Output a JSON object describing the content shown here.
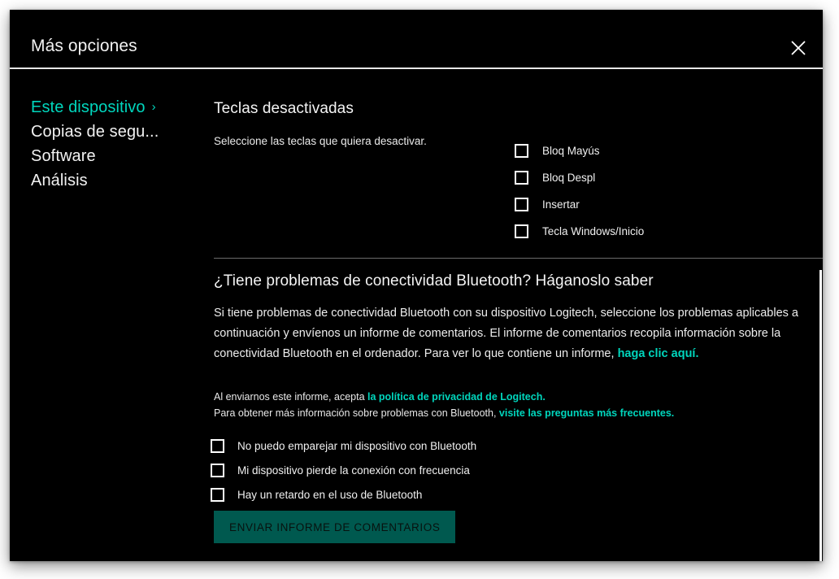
{
  "window": {
    "title": "Más opciones",
    "close_icon": "close-icon"
  },
  "colors": {
    "background": "#000000",
    "accent_teal": "#00d6bd",
    "button_bg": "#00594f",
    "text": "#f2f2f2",
    "divider": "#6b6b6b"
  },
  "sidebar": {
    "items": [
      {
        "label": "Este dispositivo",
        "active": true,
        "chevron": "›"
      },
      {
        "label": "Copias de segu...",
        "active": false
      },
      {
        "label": "Software",
        "active": false
      },
      {
        "label": "Análisis",
        "active": false
      }
    ]
  },
  "disabled_keys_section": {
    "title": "Teclas desactivadas",
    "subtitle": "Seleccione las teclas que quiera desactivar.",
    "checkboxes": [
      {
        "label": "Bloq Mayús",
        "checked": false
      },
      {
        "label": "Bloq Despl",
        "checked": false
      },
      {
        "label": "Insertar",
        "checked": false
      },
      {
        "label": "Tecla Windows/Inicio",
        "checked": false
      }
    ]
  },
  "bluetooth_section": {
    "title": "¿Tiene problemas de conectividad Bluetooth? Háganoslo saber",
    "paragraph_part1": "Si tiene problemas de conectividad Bluetooth con su dispositivo Logitech, seleccione los problemas aplicables a continuación y envíenos un informe de comentarios. El informe de comentarios recopila información sobre la conectividad Bluetooth en el ordenador. Para ver lo que contiene un informe, ",
    "paragraph_link": "haga clic aquí.",
    "fine_line1_text": "Al enviarnos este informe, acepta ",
    "fine_line1_link": "la política de privacidad de Logitech.",
    "fine_line2_text": "Para obtener más información sobre problemas con Bluetooth, ",
    "fine_line2_link": "visite las preguntas más frecuentes.",
    "issue_checkboxes": [
      {
        "label": "No puedo emparejar mi dispositivo con Bluetooth",
        "checked": false
      },
      {
        "label": "Mi dispositivo pierde la conexión con frecuencia",
        "checked": false
      },
      {
        "label": "Hay un retardo en el uso de Bluetooth",
        "checked": false
      }
    ],
    "submit_label": "ENVIAR INFORME DE COMENTARIOS"
  },
  "scrollbar": {
    "visible": true
  }
}
